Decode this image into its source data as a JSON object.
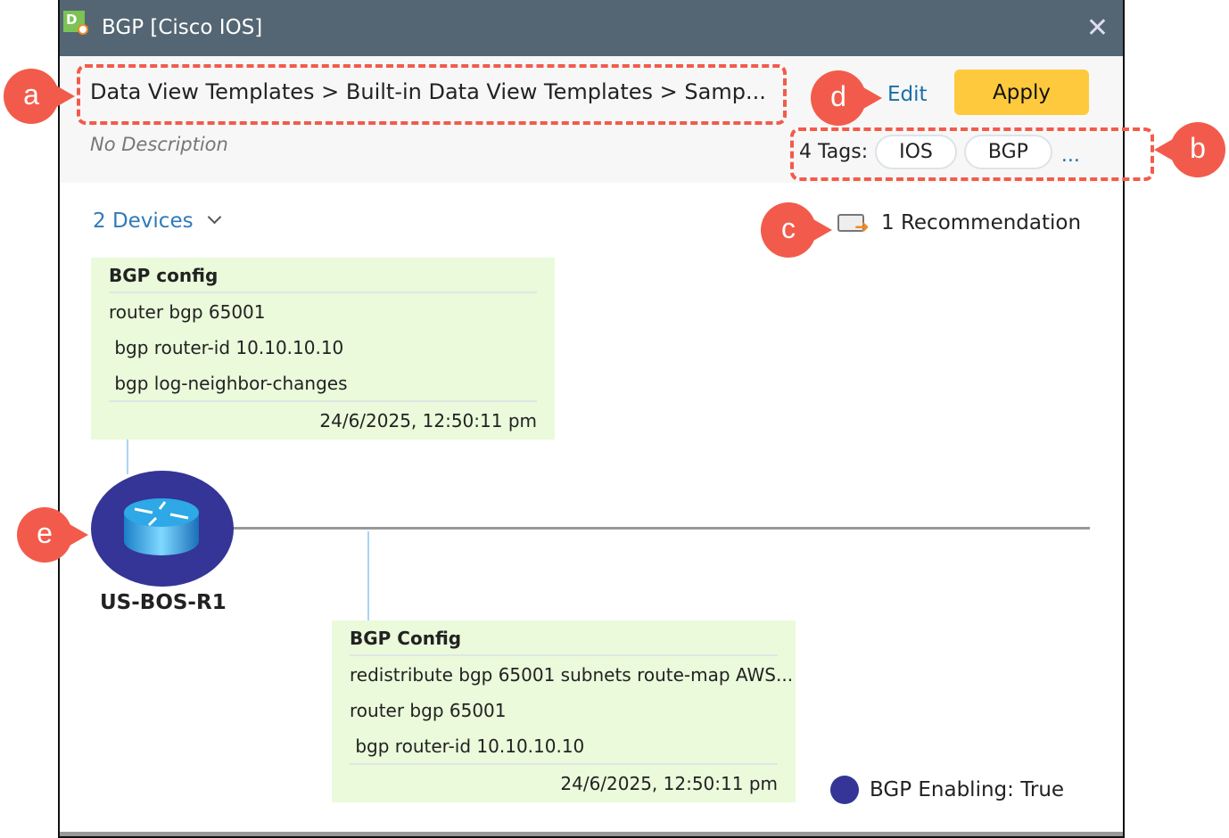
{
  "window": {
    "title": "BGP [Cisco IOS]",
    "app_icon_letter": "D"
  },
  "header": {
    "breadcrumb": "Data View Templates > Built-in Data View Templates > Samp...",
    "description": "No Description",
    "edit_label": "Edit",
    "apply_label": "Apply",
    "tags_label": "4 Tags:",
    "tags": [
      "IOS",
      "BGP"
    ],
    "more_tags": "..."
  },
  "main": {
    "devices_label": "2 Devices",
    "recommendation_label": "1 Recommendation",
    "cards": [
      {
        "title": "BGP config",
        "lines": [
          "router bgp 65001",
          " bgp router-id 10.10.10.10",
          " bgp log-neighbor-changes"
        ],
        "timestamp": "24/6/2025, 12:50:11 pm"
      },
      {
        "title": "BGP Config",
        "lines": [
          "redistribute bgp 65001 subnets route-map AWS...",
          "router bgp 65001",
          " bgp router-id 10.10.10.10"
        ],
        "timestamp": "24/6/2025, 12:50:11 pm"
      }
    ],
    "device_name": "US-BOS-R1",
    "legend": "BGP Enabling: True"
  },
  "annotations": {
    "a": "a",
    "b": "b",
    "c": "c",
    "d": "d",
    "e": "e"
  },
  "colors": {
    "titlebar": "#546673",
    "apply": "#fec93c",
    "link": "#2f7ab8",
    "card": "#eafadb",
    "device": "#343596",
    "callout": "#f25b4b"
  }
}
